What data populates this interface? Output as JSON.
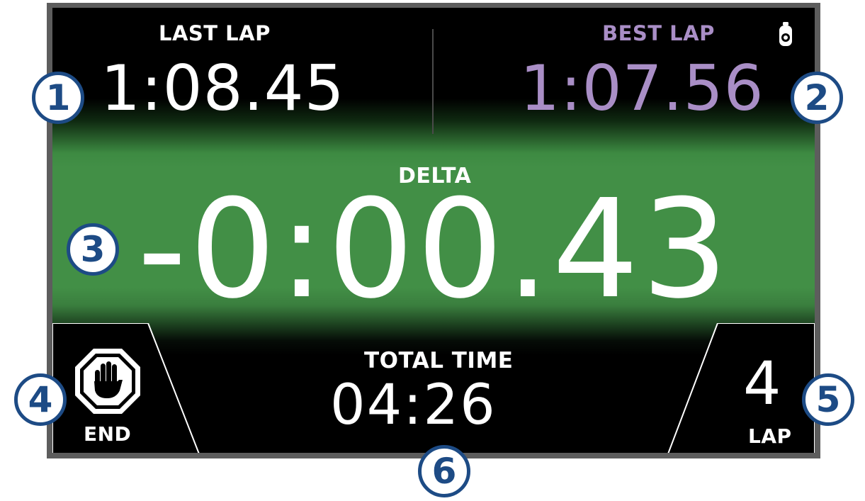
{
  "last_lap": {
    "label": "LAST LAP",
    "value": "1:08.45"
  },
  "best_lap": {
    "label": "BEST LAP",
    "value": "1:07.56"
  },
  "delta": {
    "label": "DELTA",
    "value": "-0:00.43"
  },
  "total_time": {
    "label": "TOTAL TIME",
    "value": "04:26"
  },
  "end_button": {
    "label": "END",
    "icon": "stop-hand-icon"
  },
  "lap_counter": {
    "value": "4",
    "label": "LAP"
  },
  "status_icon": "stopwatch-icon",
  "callouts": [
    "1",
    "2",
    "3",
    "4",
    "5",
    "6"
  ],
  "colors": {
    "best_lap": "#a98ec6",
    "delta_background": "#428f46",
    "callout": "#1d4b85",
    "bezel": "#5d5d5d"
  }
}
